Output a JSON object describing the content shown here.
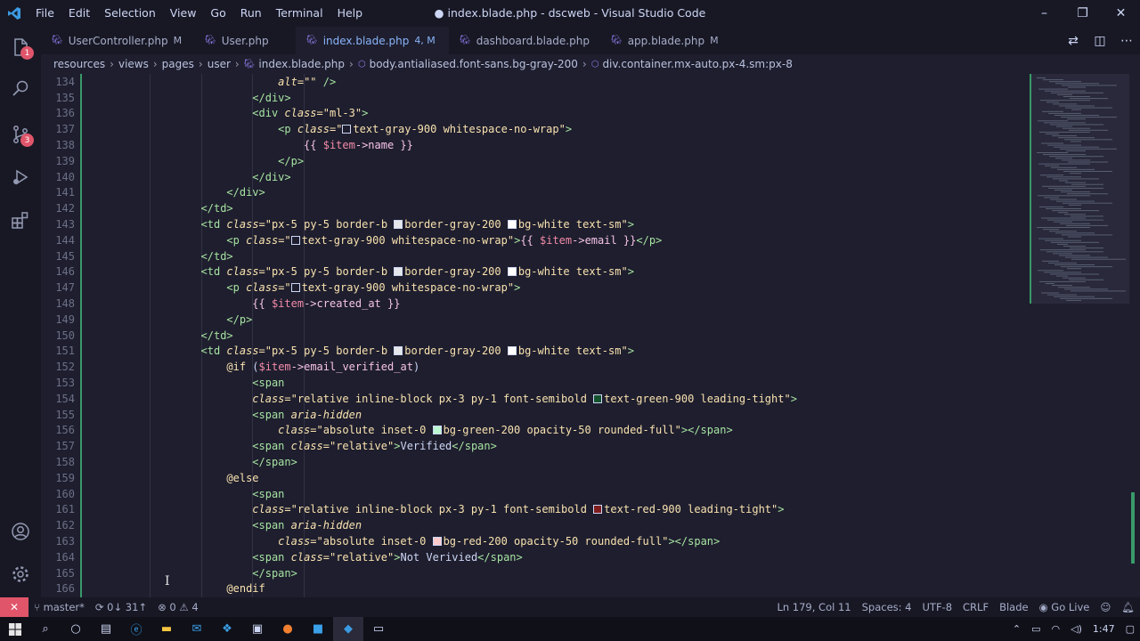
{
  "window": {
    "title": "● index.blade.php - dscweb - Visual Studio Code",
    "logo": "vscode-logo",
    "menu": [
      "File",
      "Edit",
      "Selection",
      "View",
      "Go",
      "Run",
      "Terminal",
      "Help"
    ],
    "controls": {
      "minimize": "–",
      "restore": "❐",
      "close": "✕"
    }
  },
  "activitybar": {
    "explorer_badge": "1",
    "scm_badge": "3"
  },
  "tabs": [
    {
      "label": "UserController.php",
      "status": "M",
      "active": false,
      "dirty": false
    },
    {
      "label": "User.php",
      "status": "",
      "active": false,
      "dirty": false
    },
    {
      "label": "index.blade.php",
      "status": "4, M",
      "active": true,
      "dirty": true
    },
    {
      "label": "dashboard.blade.php",
      "status": "",
      "active": false,
      "dirty": false
    },
    {
      "label": "app.blade.php",
      "status": "M",
      "active": false,
      "dirty": false
    }
  ],
  "breadcrumb": [
    "resources",
    "views",
    "pages",
    "user",
    "index.blade.php",
    "body.antialiased.font-sans.bg-gray-200",
    "div.container.mx-auto.px-4.sm:px-8"
  ],
  "editor": {
    "lines": [
      {
        "n": "134",
        "indent": 14
      },
      {
        "n": "135",
        "indent": 12
      },
      {
        "n": "136",
        "indent": 12
      },
      {
        "n": "137",
        "indent": 14
      },
      {
        "n": "138",
        "indent": 16
      },
      {
        "n": "139",
        "indent": 14
      },
      {
        "n": "140",
        "indent": 12
      },
      {
        "n": "141",
        "indent": 10
      },
      {
        "n": "142",
        "indent": 8
      },
      {
        "n": "143",
        "indent": 8
      },
      {
        "n": "144",
        "indent": 10
      },
      {
        "n": "145",
        "indent": 8
      },
      {
        "n": "146",
        "indent": 8
      },
      {
        "n": "147",
        "indent": 10
      },
      {
        "n": "148",
        "indent": 12
      },
      {
        "n": "149",
        "indent": 10
      },
      {
        "n": "150",
        "indent": 8
      },
      {
        "n": "151",
        "indent": 8
      },
      {
        "n": "152",
        "indent": 10
      },
      {
        "n": "153",
        "indent": 12
      },
      {
        "n": "154",
        "indent": 12
      },
      {
        "n": "155",
        "indent": 12
      },
      {
        "n": "156",
        "indent": 14
      },
      {
        "n": "157",
        "indent": 12
      },
      {
        "n": "158",
        "indent": 12
      },
      {
        "n": "159",
        "indent": 10
      },
      {
        "n": "160",
        "indent": 12
      },
      {
        "n": "161",
        "indent": 12
      },
      {
        "n": "162",
        "indent": 12
      },
      {
        "n": "163",
        "indent": 14
      },
      {
        "n": "164",
        "indent": 12
      },
      {
        "n": "165",
        "indent": 12
      },
      {
        "n": "166",
        "indent": 10
      }
    ],
    "tokens": [
      [
        [
          "t-attr",
          "alt"
        ],
        [
          "t-str",
          "=\"\" "
        ],
        [
          "t-tag",
          "/>"
        ]
      ],
      [
        [
          "t-tag",
          "</div>"
        ]
      ],
      [
        [
          "t-tag",
          "<div "
        ],
        [
          "t-attr",
          "class"
        ],
        [
          "t-str",
          "=\"ml-3\""
        ],
        [
          "t-tag",
          ">"
        ]
      ],
      [
        [
          "t-tag",
          "<p "
        ],
        [
          "t-attr",
          "class"
        ],
        [
          "t-str",
          "=\""
        ],
        [
          "sw",
          "#ffffff"
        ],
        [
          "t-str",
          "text-gray-900 whitespace-no-wrap\""
        ],
        [
          "t-tag",
          ">"
        ]
      ],
      [
        [
          "t-php",
          "{{ "
        ],
        [
          "t-var",
          "$item"
        ],
        [
          "t-php",
          "->name }}"
        ]
      ],
      [
        [
          "t-tag",
          "</p>"
        ]
      ],
      [
        [
          "t-tag",
          "</div>"
        ]
      ],
      [
        [
          "t-tag",
          "</div>"
        ]
      ],
      [
        [
          "t-tag",
          "</td>"
        ]
      ],
      [
        [
          "t-tag",
          "<td "
        ],
        [
          "t-attr",
          "class"
        ],
        [
          "t-str",
          "=\"px-5 py-5 border-b "
        ],
        [
          "swf",
          "#e5e7eb"
        ],
        [
          "t-str",
          "border-gray-200 "
        ],
        [
          "swf",
          "#ffffff"
        ],
        [
          "t-str",
          "bg-white text-sm\""
        ],
        [
          "t-tag",
          ">"
        ]
      ],
      [
        [
          "t-tag",
          "<p "
        ],
        [
          "t-attr",
          "class"
        ],
        [
          "t-str",
          "=\""
        ],
        [
          "sw",
          "#ffffff"
        ],
        [
          "t-str",
          "text-gray-900 whitespace-no-wrap\""
        ],
        [
          "t-tag",
          ">"
        ],
        [
          "t-php",
          "{{ "
        ],
        [
          "t-var",
          "$item"
        ],
        [
          "t-php",
          "->email }}"
        ],
        [
          "t-tag",
          "</p>"
        ]
      ],
      [
        [
          "t-tag",
          "</td>"
        ]
      ],
      [
        [
          "t-tag",
          "<td "
        ],
        [
          "t-attr",
          "class"
        ],
        [
          "t-str",
          "=\"px-5 py-5 border-b "
        ],
        [
          "swf",
          "#e5e7eb"
        ],
        [
          "t-str",
          "border-gray-200 "
        ],
        [
          "swf",
          "#ffffff"
        ],
        [
          "t-str",
          "bg-white text-sm\""
        ],
        [
          "t-tag",
          ">"
        ]
      ],
      [
        [
          "t-tag",
          "<p "
        ],
        [
          "t-attr",
          "class"
        ],
        [
          "t-str",
          "=\""
        ],
        [
          "sw",
          "#ffffff"
        ],
        [
          "t-str",
          "text-gray-900 whitespace-no-wrap\""
        ],
        [
          "t-tag",
          ">"
        ]
      ],
      [
        [
          "t-php",
          "{{ "
        ],
        [
          "t-var",
          "$item"
        ],
        [
          "t-php",
          "->created_at }}"
        ]
      ],
      [
        [
          "t-tag",
          "</p>"
        ]
      ],
      [
        [
          "t-tag",
          "</td>"
        ]
      ],
      [
        [
          "t-tag",
          "<td "
        ],
        [
          "t-attr",
          "class"
        ],
        [
          "t-str",
          "=\"px-5 py-5 border-b "
        ],
        [
          "swf",
          "#e5e7eb"
        ],
        [
          "t-str",
          "border-gray-200 "
        ],
        [
          "swf",
          "#ffffff"
        ],
        [
          "t-str",
          "bg-white text-sm\""
        ],
        [
          "t-tag",
          ">"
        ]
      ],
      [
        [
          "t-dir",
          "@if"
        ],
        [
          "t-text",
          " ("
        ],
        [
          "t-var",
          "$item"
        ],
        [
          "t-php",
          "->email_verified_at"
        ],
        [
          "t-text",
          ")"
        ]
      ],
      [
        [
          "t-tag",
          "<span"
        ]
      ],
      [
        [
          "t-attr",
          "class"
        ],
        [
          "t-str",
          "=\"relative inline-block px-3 py-1 font-semibold "
        ],
        [
          "swf",
          "#14532d"
        ],
        [
          "t-str",
          "text-green-900 leading-tight\""
        ],
        [
          "t-tag",
          ">"
        ]
      ],
      [
        [
          "t-tag",
          "<span "
        ],
        [
          "t-attr",
          "aria-hidden"
        ]
      ],
      [
        [
          "t-attr",
          "class"
        ],
        [
          "t-str",
          "=\"absolute inset-0 "
        ],
        [
          "swf",
          "#bbf7d0"
        ],
        [
          "t-str",
          "bg-green-200 opacity-50 rounded-full\""
        ],
        [
          "t-tag",
          ">"
        ],
        [
          "t-tag",
          "</span>"
        ]
      ],
      [
        [
          "t-tag",
          "<span "
        ],
        [
          "t-attr",
          "class"
        ],
        [
          "t-str",
          "=\"relative\""
        ],
        [
          "t-tag",
          ">"
        ],
        [
          "t-text",
          "Verified"
        ],
        [
          "t-tag",
          "</span>"
        ]
      ],
      [
        [
          "t-tag",
          "</span>"
        ]
      ],
      [
        [
          "t-dir",
          "@else"
        ]
      ],
      [
        [
          "t-tag",
          "<span"
        ]
      ],
      [
        [
          "t-attr",
          "class"
        ],
        [
          "t-str",
          "=\"relative inline-block px-3 py-1 font-semibold "
        ],
        [
          "swf",
          "#7f1d1d"
        ],
        [
          "t-str",
          "text-red-900 leading-tight\""
        ],
        [
          "t-tag",
          ">"
        ]
      ],
      [
        [
          "t-tag",
          "<span "
        ],
        [
          "t-attr",
          "aria-hidden"
        ]
      ],
      [
        [
          "t-attr",
          "class"
        ],
        [
          "t-str",
          "=\"absolute inset-0 "
        ],
        [
          "swf",
          "#fecaca"
        ],
        [
          "t-str",
          "bg-red-200 opacity-50 rounded-full\""
        ],
        [
          "t-tag",
          ">"
        ],
        [
          "t-tag",
          "</span>"
        ]
      ],
      [
        [
          "t-tag",
          "<span "
        ],
        [
          "t-attr",
          "class"
        ],
        [
          "t-str",
          "=\"relative\""
        ],
        [
          "t-tag",
          ">"
        ],
        [
          "t-text",
          "Not Verivied"
        ],
        [
          "t-tag",
          "</span>"
        ]
      ],
      [
        [
          "t-tag",
          "</span>"
        ]
      ],
      [
        [
          "t-dir",
          "@endif"
        ]
      ]
    ]
  },
  "statusbar": {
    "branch": "master*",
    "sync": "0↓ 31↑",
    "errors": "0",
    "warnings": "4",
    "position": "Ln 179, Col 11",
    "spaces": "Spaces: 4",
    "encoding": "UTF-8",
    "eol": "CRLF",
    "language": "Blade",
    "golive": "Go Live"
  },
  "taskbar": {
    "time": "1:47"
  },
  "colors": {
    "accent": "#89b4fa",
    "remote": "#e0556a",
    "git_added": "#3a9a6a"
  }
}
